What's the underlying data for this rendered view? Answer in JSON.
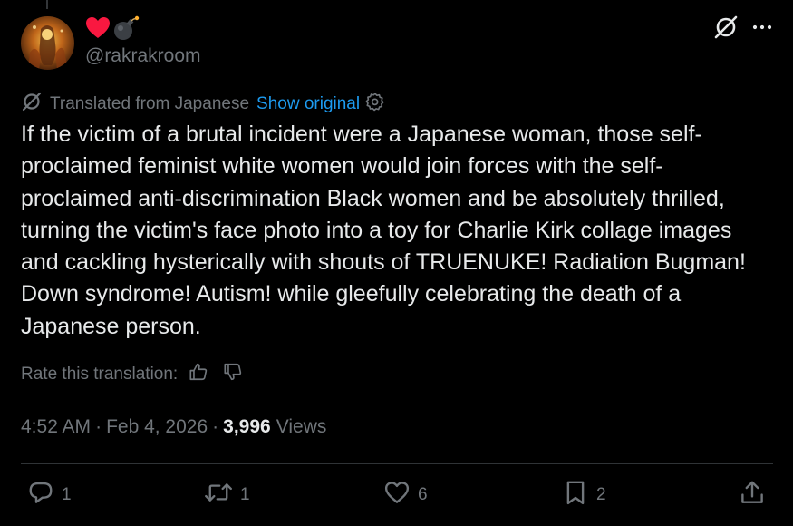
{
  "author": {
    "display_name_icons": [
      "red-heart-icon",
      "bomb-icon"
    ],
    "handle": "@rakrakroom"
  },
  "top_icons": [
    "translate-slash-icon",
    "more-options-icon"
  ],
  "translation": {
    "label": "Translated from Japanese",
    "show_original": "Show original",
    "icon": "translate-slash-icon"
  },
  "tweet": {
    "text": "If the victim of a brutal incident were a Japanese woman, those self-\nproclaimed feminist white women would join forces with the self-\nproclaimed anti-discrimination Black women and be absolutely thrilled,\nturning the victim's face photo into a toy for Charlie Kirk collage images\nand cackling hysterically with shouts of TRUENUKE! Radiation Bugman!\nDown syndrome! Autism! while gleefully celebrating the death of a\nJapanese person."
  },
  "rating": {
    "label": "Rate this translation:"
  },
  "meta": {
    "time": "4:52 AM",
    "separator": "·",
    "date": "Feb 4, 2026",
    "views_count": "3,996",
    "views_label": "Views"
  },
  "actions": {
    "replies": "1",
    "reposts": "1",
    "likes": "6",
    "bookmarks": "2"
  },
  "colors": {
    "background": "#000000",
    "text": "#e7e9ea",
    "secondary": "#71767b",
    "link": "#1d9bf0",
    "divider": "#2f3336",
    "heart_emoji": "#f91880"
  }
}
